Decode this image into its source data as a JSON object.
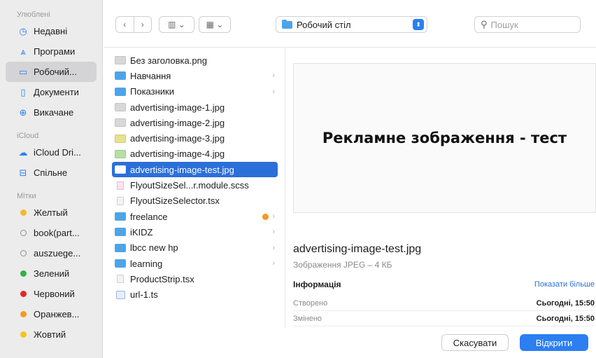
{
  "sidebar": {
    "favorites_title": "Улюблені",
    "favorites": [
      {
        "label": "Недавні",
        "icon": "clock-icon",
        "glyph": "◷"
      },
      {
        "label": "Програми",
        "icon": "apps-icon",
        "glyph": "⩓"
      },
      {
        "label": "Робочий...",
        "icon": "desktop-icon",
        "glyph": "▭"
      },
      {
        "label": "Документи",
        "icon": "document-icon",
        "glyph": "▯"
      },
      {
        "label": "Викачане",
        "icon": "download-icon",
        "glyph": "⊕"
      }
    ],
    "icloud_title": "iCloud",
    "icloud": [
      {
        "label": "iCloud Dri...",
        "icon": "cloud-icon",
        "glyph": "☁"
      },
      {
        "label": "Спільне",
        "icon": "shared-folder-icon",
        "glyph": "⊟"
      }
    ],
    "tags_title": "Мітки",
    "tags": [
      {
        "label": "Желтый",
        "color": "#f5b82e",
        "ring": false
      },
      {
        "label": "book(part...",
        "color": "",
        "ring": true
      },
      {
        "label": "auszuege...",
        "color": "",
        "ring": true
      },
      {
        "label": "Зелений",
        "color": "#2fb344",
        "ring": false
      },
      {
        "label": "Червоний",
        "color": "#e8262a",
        "ring": false
      },
      {
        "label": "Оранжев...",
        "color": "#f39a1f",
        "ring": false
      },
      {
        "label": "Жовтий",
        "color": "#f5c518",
        "ring": false
      }
    ]
  },
  "toolbar": {
    "back_glyph": "‹",
    "forward_glyph": "›",
    "view_glyph": "▥ ⌄",
    "group_glyph": "▦ ⌄",
    "location": "Робочий стіл",
    "location_stepper_glyph": "⬍",
    "search_placeholder": "Пошук",
    "search_glyph": "⚲"
  },
  "files": [
    {
      "name": "Без заголовка.png",
      "icon": "img",
      "chevron": false,
      "tag": false
    },
    {
      "name": "Навчання",
      "icon": "folder",
      "chevron": true,
      "tag": false
    },
    {
      "name": "Показники",
      "icon": "folder",
      "chevron": true,
      "tag": false
    },
    {
      "name": "advertising-image-1.jpg",
      "icon": "img",
      "chevron": false,
      "tag": false
    },
    {
      "name": "advertising-image-2.jpg",
      "icon": "img",
      "chevron": false,
      "tag": false
    },
    {
      "name": "advertising-image-3.jpg",
      "icon": "img-y",
      "chevron": false,
      "tag": false
    },
    {
      "name": "advertising-image-4.jpg",
      "icon": "img-g",
      "chevron": false,
      "tag": false
    },
    {
      "name": "advertising-image-test.jpg",
      "icon": "img-sel",
      "chevron": false,
      "tag": false,
      "selected": true
    },
    {
      "name": "FlyoutSizeSel...r.module.scss",
      "icon": "scss",
      "chevron": false,
      "tag": false
    },
    {
      "name": "FlyoutSizeSelector.tsx",
      "icon": "code",
      "chevron": false,
      "tag": false
    },
    {
      "name": "freelance",
      "icon": "folder",
      "chevron": true,
      "tag": true
    },
    {
      "name": "iKIDZ",
      "icon": "folder",
      "chevron": true,
      "tag": false
    },
    {
      "name": "lbcc new hp",
      "icon": "folder",
      "chevron": true,
      "tag": false
    },
    {
      "name": "learning",
      "icon": "folder",
      "chevron": true,
      "tag": false
    },
    {
      "name": "ProductStrip.tsx",
      "icon": "code",
      "chevron": false,
      "tag": false
    },
    {
      "name": "url-1.ts",
      "icon": "ts",
      "chevron": false,
      "tag": false
    }
  ],
  "preview": {
    "image_text": "Рекламне зображення - тест",
    "file_name": "advertising-image-test.jpg",
    "kind": "Зображення JPEG – 4 КБ",
    "info_title": "Інформація",
    "show_more": "Показати більше",
    "rows": [
      {
        "label": "Створено",
        "value": "Сьогодні, 15:50"
      },
      {
        "label": "Змінено",
        "value": "Сьогодні, 15:50"
      }
    ]
  },
  "footer": {
    "cancel": "Скасувати",
    "open": "Відкрити"
  }
}
